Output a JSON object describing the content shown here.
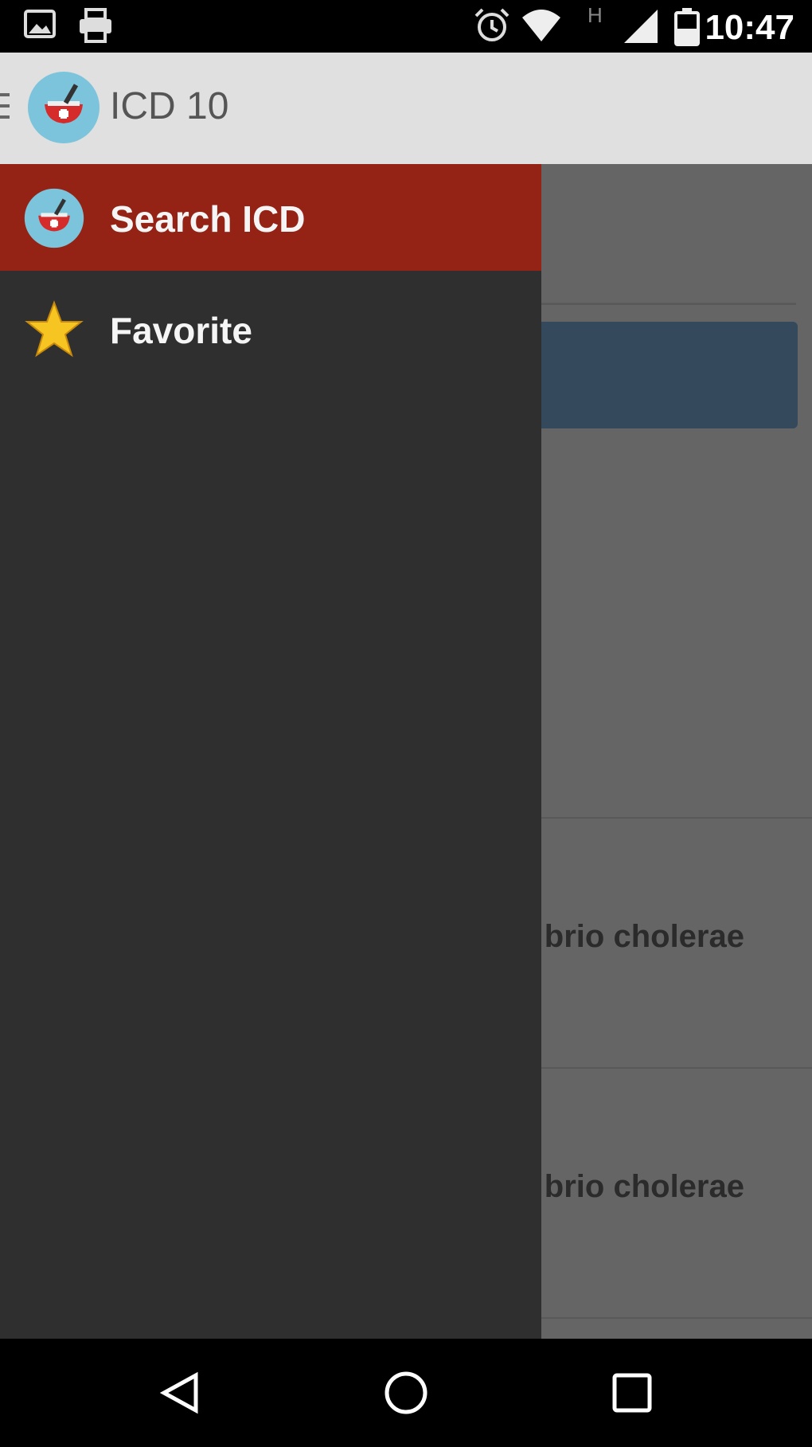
{
  "status_bar": {
    "time": "10:47",
    "icons": [
      "image-icon",
      "printer-icon",
      "alarm-icon",
      "wifi-icon",
      "signal-icon",
      "battery-icon"
    ]
  },
  "toolbar": {
    "title": "ICD 10",
    "icons": [
      "menu-icon",
      "app-logo-icon"
    ]
  },
  "drawer": {
    "items": [
      {
        "label": "Search ICD",
        "icon": "app-logo-icon",
        "active": true
      },
      {
        "label": "Favorite",
        "icon": "star-icon",
        "active": false
      }
    ]
  },
  "main": {
    "results": [
      {
        "text": "brio cholerae"
      },
      {
        "text": "brio cholerae"
      }
    ]
  },
  "nav_bar": {
    "icons": [
      "back-icon",
      "home-icon",
      "recents-icon"
    ]
  },
  "colors": {
    "drawer_bg": "#2f2f2f",
    "drawer_active": "#942316",
    "toolbar_bg": "#e0e0e0",
    "scrim": "#656565",
    "button": "#35495c"
  }
}
